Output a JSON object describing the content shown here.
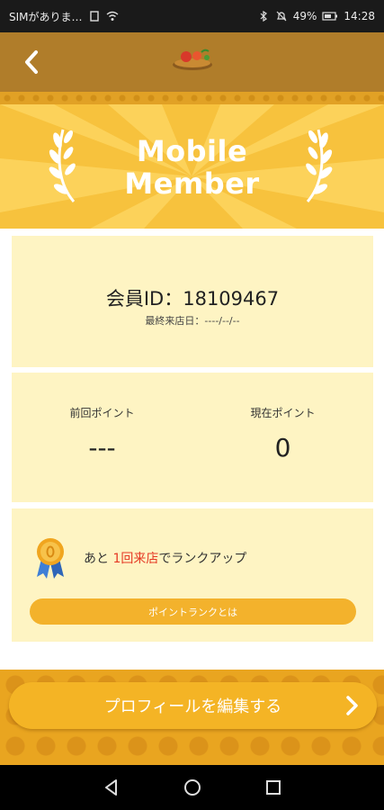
{
  "status_bar": {
    "carrier": "SIMがありま…",
    "battery": "49%",
    "time": "14:28"
  },
  "header": {
    "back_icon": "chevron-left-icon",
    "logo_icon": "restaurant-logo-icon"
  },
  "hero": {
    "title_line1": "Mobile",
    "title_line2": "Member"
  },
  "member": {
    "id_label": "会員ID：18109467",
    "last_visit": "最終来店日：----/--/--"
  },
  "points": {
    "previous_label": "前回ポイント",
    "previous_value": "---",
    "current_label": "現在ポイント",
    "current_value": "0"
  },
  "rank": {
    "prefix": "あと ",
    "highlight": "1回来店",
    "suffix": "でランクアップ",
    "button_label": "ポイントランクとは"
  },
  "profile_button": {
    "label": "プロフィールを編集する"
  },
  "colors": {
    "header": "#b07d2a",
    "hero": "#f7c23d",
    "card": "#fef4c3",
    "accent": "#f4b425",
    "highlight_text": "#e53a25"
  }
}
